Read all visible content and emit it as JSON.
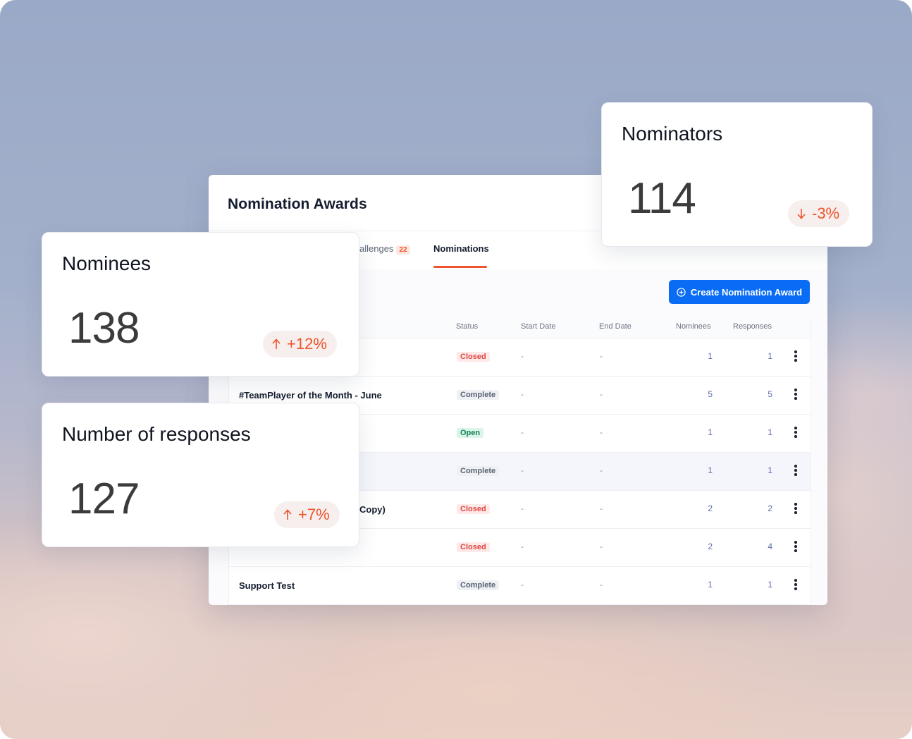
{
  "panel": {
    "title": "Nomination Awards",
    "tabs": [
      {
        "label": "allenges",
        "badge": "22"
      },
      {
        "label": "Nominations",
        "active": true
      }
    ],
    "create_button_label": "Create Nomination Award",
    "accent_color": "#f0522b",
    "button_color": "#0a6cf5"
  },
  "table": {
    "headers": [
      "Status",
      "Start Date",
      "End Date",
      "Nominees",
      "Responses"
    ],
    "rows": [
      {
        "name": "",
        "status": "Closed",
        "start": "-",
        "end": "-",
        "nominees": "1",
        "responses": "1"
      },
      {
        "name": "#TeamPlayer of the Month - June",
        "status": "Complete",
        "start": "-",
        "end": "-",
        "nominees": "5",
        "responses": "5"
      },
      {
        "name": "",
        "status": "Open",
        "start": "-",
        "end": "-",
        "nominees": "1",
        "responses": "1"
      },
      {
        "name": "",
        "status": "Complete",
        "start": "-",
        "end": "-",
        "nominees": "1",
        "responses": "1"
      },
      {
        "name": "Copy)",
        "status": "Closed",
        "start": "-",
        "end": "-",
        "nominees": "2",
        "responses": "2"
      },
      {
        "name": "",
        "status": "Closed",
        "start": "-",
        "end": "-",
        "nominees": "2",
        "responses": "4"
      },
      {
        "name": "Support Test",
        "status": "Complete",
        "start": "-",
        "end": "-",
        "nominees": "1",
        "responses": "1"
      }
    ]
  },
  "stats": {
    "nominators": {
      "title": "Nominators",
      "value": "114",
      "delta": "-3%",
      "direction": "down"
    },
    "nominees": {
      "title": "Nominees",
      "value": "138",
      "delta": "+12%",
      "direction": "up"
    },
    "responses": {
      "title": "Number of responses",
      "value": "127",
      "delta": "+7%",
      "direction": "up"
    }
  }
}
